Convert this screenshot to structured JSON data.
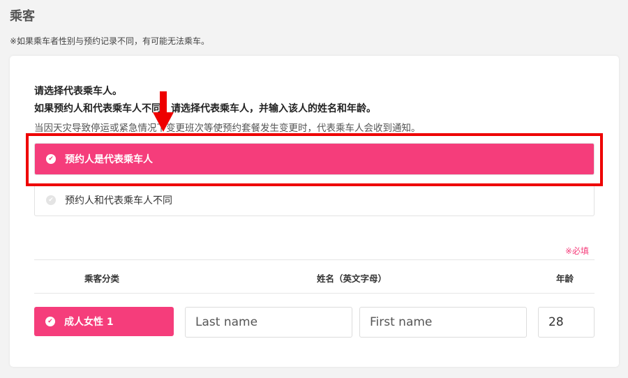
{
  "section": {
    "title": "乘客",
    "notice": "※如果乘车者性别与预约记录不同，有可能无法乘车。"
  },
  "instructions": {
    "line1": "请选择代表乘车人。",
    "line2": "如果预约人和代表乘车人不同，请选择代表乘车人，并输入该人的姓名和年龄。",
    "line3": "当因天灾导致停运或紧急情况下变更班次等使预约套餐发生变更时，代表乘车人会收到通知。"
  },
  "options": [
    {
      "label": "预约人是代表乘车人",
      "selected": true
    },
    {
      "label": "预约人和代表乘车人不同",
      "selected": false
    }
  ],
  "required_label": "※必填",
  "table": {
    "headers": {
      "category": "乘客分类",
      "name": "姓名（英文字母）",
      "age": "年龄"
    },
    "rows": [
      {
        "category": "成人女性 1",
        "last_name_value": "",
        "last_name_placeholder": "Last name",
        "first_name_value": "",
        "first_name_placeholder": "First name",
        "age": "28"
      }
    ]
  },
  "icons": {
    "check": "✔"
  },
  "colors": {
    "accent": "#f53d7b",
    "annotation": "#ee0000"
  }
}
